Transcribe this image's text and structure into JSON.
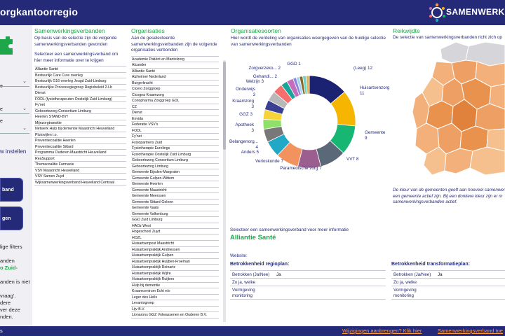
{
  "header": {
    "title": "orgkantoorregio",
    "logo_text": "SAMENWERKINGSV"
  },
  "sidebar": {
    "labels": [
      "e",
      "e",
      "e"
    ],
    "selects": [
      {
        "value": ""
      },
      {
        "value": "e"
      },
      {
        "value": ""
      }
    ],
    "link": "w instellen",
    "buttons": [
      "band",
      "gen"
    ],
    "texts": [
      "lige filters",
      "anden",
      "o Zuid-",
      "anden is niet",
      "vraag'.",
      "dere",
      "ver deze",
      "nden."
    ]
  },
  "col1": {
    "title": "Samenwerkingsverbanden",
    "desc": "Op basis van de selectie zijn de volgende samenwerkingsverbanden gevonden",
    "hint": "Selecteer een samenwerkingsverband om hier meer informatie over te krijgen",
    "items": [
      "Alliantie Santé",
      "Bestuurlijk Care Cure overleg",
      "Bestuurlijk G16-overleg Jeugd Zuid-Limburg",
      "Bestuurlijke Procesregiegroep Regiobeleid 2-Lb",
      "Dienst",
      "FODL (fysiotherapeuten Oostelijk Zuid Limburg)",
      "Fy'net",
      "Geboortezorg Consortium Limburg",
      "Heerlen STAND-BY!",
      "Mijnzorgtransitie",
      "Netwerk Hulp bij dementie Maastricht Heuvelland",
      "Plutovijlen i.o.",
      "Preventiecoalitie Heerlen",
      "Preventiecoalitie Sittard",
      "Programma Ouderen Maastricht Heuvelland",
      "ReaSupport",
      "Themacoalitie Farmacie",
      "VSV Maastricht Heuvelland",
      "VSV Samen Zuyd",
      "Wijksamenwerkingsverband Heuvelland Centraal"
    ]
  },
  "col2": {
    "title": "Organisaties",
    "desc": "Aan de geselecteerde samenwerkingsverbanden zijn de volgende organisaties verbonden",
    "items": [
      "Academie Patiënt en Mantelzorg",
      "Alcander",
      "Alliantie Santé",
      "Alzheimer Nederland",
      "Burgerkracht",
      "Cicero Zorggroep",
      "Cicogna Kraamzorg",
      "Coriopharma Zorggroep GDL",
      "CZ",
      "Dienst",
      "Envida",
      "Federatie VSV's",
      "FODL",
      "Fy'net",
      "Fysiopartners Zuid",
      "Fysiotherapie Eurelings",
      "Fysiotherapie Oostelijk Zuid Limburg",
      "Geboortezorg Consortium Limburg",
      "Geboortezorg Limburg",
      "Gemeente Eijsden-Margraten",
      "Gemeente Gulpen-Wittem",
      "Gemeente Heerlen",
      "Gemeente Maastricht",
      "Gemeente Meerssen",
      "Gemeente Sittard-Geleen",
      "Gemeente Vaals",
      "Gemeente Valkenburg",
      "GGD Zuid Limburg",
      "HAOz West",
      "Hogeschool Zuyd",
      "HOZL",
      "Huisartsenpost Maastricht",
      "Huisartsenpraktijk Andriessen",
      "Huisartsenpraktijk Gulpen",
      "Huisartsenpraktijk Huijben-Froeman",
      "Huisartsenpraktijk Reinartz",
      "Huisartsenpraktijk Wijlre",
      "Huisartsenpraktijk Ruijters",
      "Hulp bij dementie",
      "Kraamcentrum Echt e/o",
      "Leger des Heils",
      "Levantogroep",
      "Lijv B.V.",
      "Lionarons GGZ Volwassenen en Ouderen B.V."
    ]
  },
  "org_types": {
    "title": "Organisatiesoorten",
    "desc": "Hier wordt de verdeling van organisaties weergegeven van de huidige selectie van samenwerkingsverbanden",
    "selecteer": "Selecteer een samenwerkingsverband voor meer informatie",
    "selected": "Alliantie Santé",
    "website_label": "Website:"
  },
  "chart_data": {
    "type": "pie",
    "title": "",
    "slices": [
      {
        "label": "(Leeg) 12",
        "value": 12,
        "color": "#1c2272"
      },
      {
        "label": "Huisartsenzorg 11",
        "value": 11,
        "color": "#f5b500"
      },
      {
        "label": "Gemeente 9",
        "value": 9,
        "color": "#17b673"
      },
      {
        "label": "VVT 8",
        "value": 8,
        "color": "#5a6878"
      },
      {
        "label": "Paramedische zorg 7",
        "value": 7,
        "color": "#9a5f8e"
      },
      {
        "label": "Verloskunde 7",
        "value": 7,
        "color": "#f2925e"
      },
      {
        "label": "Anders 5",
        "value": 5,
        "color": "#21a8c7"
      },
      {
        "label": "Belangenorg... 4",
        "value": 4,
        "color": "#787878"
      },
      {
        "label": "Apotheek 3",
        "value": 3,
        "color": "#8ee06a"
      },
      {
        "label": "GGZ 3",
        "value": 3,
        "color": "#f7d33a"
      },
      {
        "label": "Kraamzorg 3",
        "value": 3,
        "color": "#3a3f92"
      },
      {
        "label": "Onderwijs 3",
        "value": 3,
        "color": "#b8b8b8"
      },
      {
        "label": "Welzijn 3",
        "value": 3,
        "color": "#f66e6e"
      },
      {
        "label": "Gehandi... 2",
        "value": 2,
        "color": "#1aa49a"
      },
      {
        "label": "Zorgverzeko... 2",
        "value": 2,
        "color": "#c66cbc"
      },
      {
        "label": "GGD 1",
        "value": 1,
        "color": "#8a86dc"
      },
      {
        "label": "Overig 1",
        "value": 1,
        "color": "#a8d4ec"
      },
      {
        "label": "Overig 1",
        "value": 1,
        "color": "#8a6a2a"
      },
      {
        "label": "Overig 1",
        "value": 1,
        "color": "#6ad6c4"
      },
      {
        "label": "Overig 1",
        "value": 1,
        "color": "#e0b05a"
      }
    ]
  },
  "regioplan": {
    "title": "Betrokkenheid regioplan:",
    "rows": [
      {
        "k": "Betrokken (Ja/Nee)",
        "v": "Ja"
      },
      {
        "k": "Zo ja, welke",
        "v": ""
      },
      {
        "k": "Vormgeving monitoring",
        "v": ""
      }
    ]
  },
  "transformatieplan": {
    "title": "Betrokkenheid transformatieplan:",
    "rows": [
      {
        "k": "Betrokken (Ja/Nee)",
        "v": "Ja"
      },
      {
        "k": "Zo ja, welke",
        "v": ""
      },
      {
        "k": "Vormgeving monitoring",
        "v": ""
      }
    ]
  },
  "reikwijdte": {
    "title": "Reikwijdte",
    "desc": "De selectie van samenwerkingsverbanden richt zich op",
    "note_lines": [
      "De kleur van de gemeenten geeft aan hoeveel samenwerk",
      "een gemeente actief zijn. Bij een donkere kleur zijn er m",
      "samenwerkingsverbanden actief."
    ]
  },
  "footer": {
    "dot": "s",
    "link1": "Wijzigingen aanbrengen? Klik hier",
    "link2": "Samenwerkingsverband toe"
  }
}
